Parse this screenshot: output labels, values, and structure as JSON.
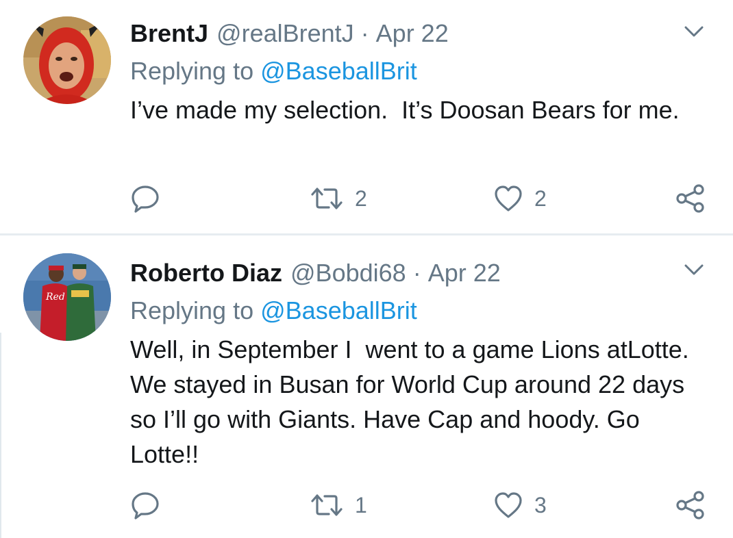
{
  "tweets": [
    {
      "author_name": "BrentJ",
      "handle": "@realBrentJ",
      "separator": "·",
      "date": "Apr 22",
      "replying_prefix": "Replying to",
      "replying_to": "@BaseballBrit",
      "text": "I’ve made my selection.  It’s Doosan Bears for me.",
      "retweets": "2",
      "likes": "2",
      "icons": {
        "reply": "reply-icon",
        "retweet": "retweet-icon",
        "like": "heart-icon",
        "share": "share-icon",
        "menu": "chevron-down-icon"
      }
    },
    {
      "author_name": "Roberto Diaz",
      "handle": "@Bobdi68",
      "separator": "·",
      "date": "Apr 22",
      "replying_prefix": "Replying to",
      "replying_to": "@BaseballBrit",
      "text": "Well, in September I  went to a game Lions atLotte. We stayed in Busan for World Cup around 22 days so I’ll go with Giants. Have Cap and hoody. Go Lotte!!",
      "retweets": "1",
      "likes": "3",
      "icons": {
        "reply": "reply-icon",
        "retweet": "retweet-icon",
        "like": "heart-icon",
        "share": "share-icon",
        "menu": "chevron-down-icon"
      }
    }
  ],
  "colors": {
    "text": "#14171a",
    "secondary": "#657786",
    "link": "#1b95e0",
    "divider": "#e6ecf0"
  }
}
